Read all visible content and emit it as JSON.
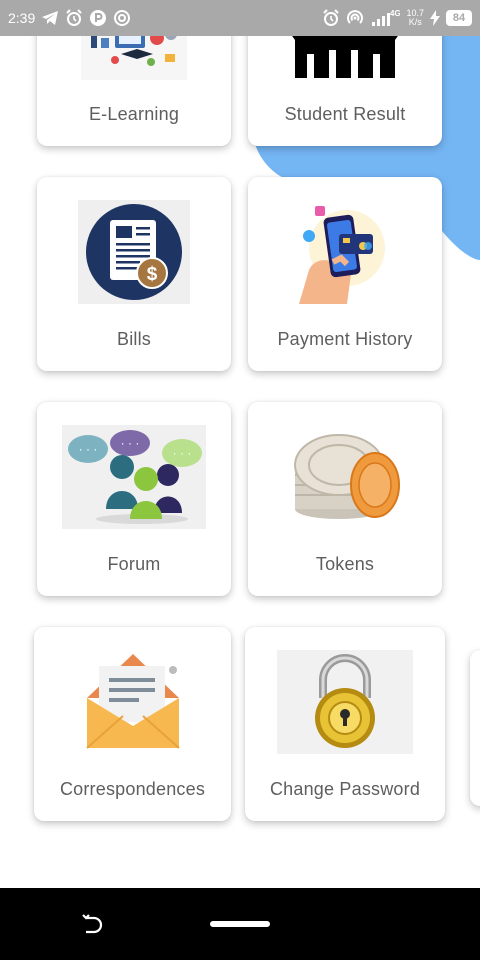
{
  "status_bar": {
    "time": "2:39",
    "network_type": "4G",
    "speed_value": "10.7",
    "speed_unit": "K/s",
    "battery": "84",
    "left_icons": [
      "telegram-icon",
      "alarm-icon",
      "p-app-icon",
      "hotspot-icon"
    ],
    "right_icons": [
      "alarm-icon",
      "hotspot-icon",
      "signal-icon",
      "charging-icon",
      "battery-icon"
    ]
  },
  "menu": {
    "items": [
      {
        "label": "E-Learning",
        "icon": "e-learning-icon"
      },
      {
        "label": "Student Result",
        "icon": "student-result-icon"
      },
      {
        "label": "Bills",
        "icon": "bills-icon"
      },
      {
        "label": "Payment History",
        "icon": "payment-history-icon"
      },
      {
        "label": "Forum",
        "icon": "forum-icon"
      },
      {
        "label": "Tokens",
        "icon": "tokens-icon"
      },
      {
        "label": "Correspondences",
        "icon": "correspondences-icon"
      },
      {
        "label": "Change Password",
        "icon": "change-password-icon"
      }
    ]
  },
  "colors": {
    "status_bar": "#a9a9a9",
    "accent_blue": "#74b5f4",
    "label_text": "#5e5e5e",
    "nav_bar": "#000000"
  }
}
